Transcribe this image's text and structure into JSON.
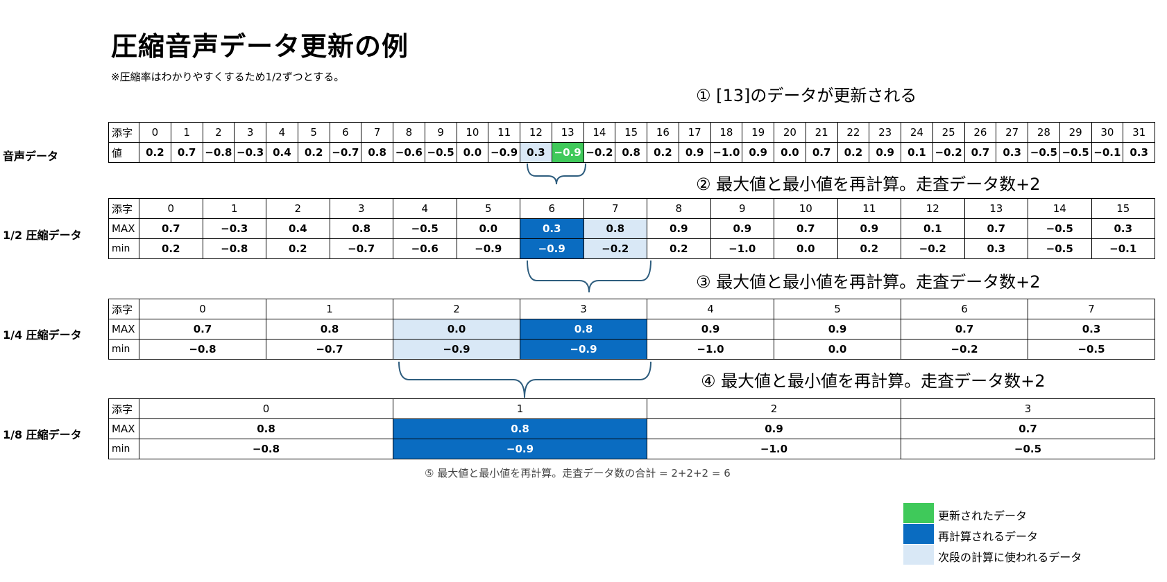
{
  "title": "圧縮音声データ更新の例",
  "note": "※圧縮率はわかりやすくするため1/2ずつとする。",
  "steps": {
    "s1": "① [13]のデータが更新される",
    "s2": "② 最大値と最小値を再計算。走査データ数+2",
    "s3": "③ 最大値と最小値を再計算。走査データ数+2",
    "s4": "④ 最大値と最小値を再計算。走査データ数+2",
    "s5": "⑤ 最大値と最小値を再計算。走査データ数の合計 = 2+2+2 = 6"
  },
  "colors": {
    "updated": "#3fc95a",
    "recalc": "#0a6cc1",
    "next": "#d9e8f6",
    "brace": "#2e5d7e"
  },
  "audio": {
    "label": "音声データ",
    "index_header": "添字",
    "value_header": "値",
    "indices": [
      "0",
      "1",
      "2",
      "3",
      "4",
      "5",
      "6",
      "7",
      "8",
      "9",
      "10",
      "11",
      "12",
      "13",
      "14",
      "15",
      "16",
      "17",
      "18",
      "19",
      "20",
      "21",
      "22",
      "23",
      "24",
      "25",
      "26",
      "27",
      "28",
      "29",
      "30",
      "31"
    ],
    "values": [
      "0.2",
      "0.7",
      "−0.8",
      "−0.3",
      "0.4",
      "0.2",
      "−0.7",
      "0.8",
      "−0.6",
      "−0.5",
      "0.0",
      "−0.9",
      "0.3",
      "−0.9",
      "−0.2",
      "0.8",
      "0.2",
      "0.9",
      "−1.0",
      "0.9",
      "0.0",
      "0.7",
      "0.2",
      "0.9",
      "0.1",
      "−0.2",
      "0.7",
      "0.3",
      "−0.5",
      "−0.5",
      "−0.1",
      "0.3"
    ],
    "highlight": {
      "12": "next",
      "13": "updated"
    }
  },
  "half": {
    "label": "1/2 圧縮データ",
    "index_header": "添字",
    "max_header": "MAX",
    "min_header": "min",
    "indices": [
      "0",
      "1",
      "2",
      "3",
      "4",
      "5",
      "6",
      "7",
      "8",
      "9",
      "10",
      "11",
      "12",
      "13",
      "14",
      "15"
    ],
    "max": [
      "0.7",
      "−0.3",
      "0.4",
      "0.8",
      "−0.5",
      "0.0",
      "0.3",
      "0.8",
      "0.9",
      "0.9",
      "0.7",
      "0.9",
      "0.1",
      "0.7",
      "−0.5",
      "0.3"
    ],
    "min": [
      "0.2",
      "−0.8",
      "0.2",
      "−0.7",
      "−0.6",
      "−0.9",
      "−0.9",
      "−0.2",
      "0.2",
      "−1.0",
      "0.0",
      "0.2",
      "−0.2",
      "0.3",
      "−0.5",
      "−0.1"
    ],
    "highlight": {
      "6": "recalc",
      "7": "next"
    }
  },
  "quarter": {
    "label": "1/4 圧縮データ",
    "index_header": "添字",
    "max_header": "MAX",
    "min_header": "min",
    "indices": [
      "0",
      "1",
      "2",
      "3",
      "4",
      "5",
      "6",
      "7"
    ],
    "max": [
      "0.7",
      "0.8",
      "0.0",
      "0.8",
      "0.9",
      "0.9",
      "0.7",
      "0.3"
    ],
    "min": [
      "−0.8",
      "−0.7",
      "−0.9",
      "−0.9",
      "−1.0",
      "0.0",
      "−0.2",
      "−0.5"
    ],
    "highlight": {
      "2": "next",
      "3": "recalc"
    }
  },
  "eighth": {
    "label": "1/8 圧縮データ",
    "index_header": "添字",
    "max_header": "MAX",
    "min_header": "min",
    "indices": [
      "0",
      "1",
      "2",
      "3"
    ],
    "max": [
      "0.8",
      "0.8",
      "0.9",
      "0.7"
    ],
    "min": [
      "−0.8",
      "−0.9",
      "−1.0",
      "−0.5"
    ],
    "highlight": {
      "1": "recalc"
    }
  },
  "legend": {
    "updated": "更新されたデータ",
    "recalc": "再計算されるデータ",
    "next": "次段の計算に使われるデータ"
  }
}
